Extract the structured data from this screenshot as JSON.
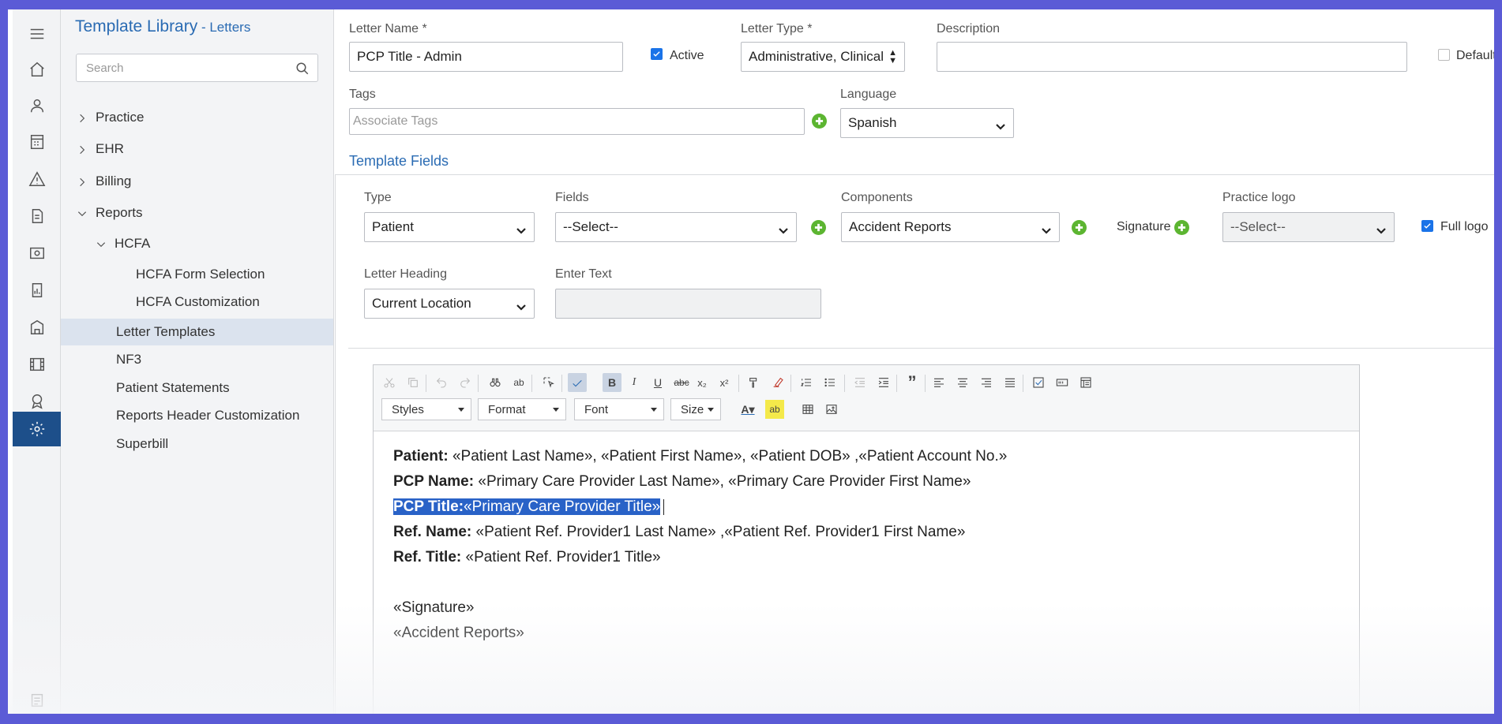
{
  "sidebar_title": {
    "main": "Template Library",
    "sub": " - Letters"
  },
  "search": {
    "placeholder": "Search"
  },
  "tree": {
    "practice": "Practice",
    "ehr": "EHR",
    "billing": "Billing",
    "reports": "Reports",
    "hcfa": "HCFA",
    "hcfa_form_selection": "HCFA Form Selection",
    "hcfa_customization": "HCFA Customization",
    "letter_templates": "Letter Templates",
    "nf3": "NF3",
    "patient_statements": "Patient Statements",
    "reports_header_customization": "Reports Header Customization",
    "superbill": "Superbill"
  },
  "form": {
    "letter_name_label": "Letter Name *",
    "letter_name_value": "PCP Title - Admin",
    "active_label": "Active",
    "active_checked": true,
    "letter_type_label": "Letter Type *",
    "letter_type_value": "Administrative, Clinical",
    "description_label": "Description",
    "description_value": "",
    "default_label": "Default",
    "default_checked": false,
    "tags_label": "Tags",
    "tags_placeholder": "Associate Tags",
    "language_label": "Language",
    "language_value": "Spanish"
  },
  "template_fields": {
    "title": "Template Fields",
    "type_label": "Type",
    "type_value": "Patient",
    "fields_label": "Fields",
    "fields_value": "--Select--",
    "components_label": "Components",
    "components_value": "Accident Reports",
    "signature_label": "Signature",
    "practice_logo_label": "Practice logo",
    "practice_logo_value": "--Select--",
    "full_logo_label": "Full logo",
    "full_logo_checked": true,
    "letter_heading_label": "Letter Heading",
    "letter_heading_value": "Current Location",
    "enter_text_label": "Enter Text",
    "enter_text_value": ""
  },
  "editor": {
    "styles": "Styles",
    "format": "Format",
    "font": "Font",
    "size": "Size",
    "lines": [
      {
        "label": "Patient:",
        "text": " «Patient Last Name», «Patient First Name», «Patient DOB» ,«Patient Account No.»"
      },
      {
        "label": "PCP Name:",
        "text": " «Primary Care Provider Last Name», «Primary Care Provider First Name»"
      },
      {
        "label": "PCP Title:",
        "text": "«Primary Care Provider Title»"
      },
      {
        "label": "Ref. Name:",
        "text": " «Patient Ref. Provider1 Last Name» ,«Patient Ref. Provider1 First Name»"
      },
      {
        "label": "Ref. Title:",
        "text": " «Patient Ref. Provider1 Title»"
      },
      {
        "label": "",
        "text": "«Signature»"
      },
      {
        "label": "",
        "text": "«Accident Reports»"
      }
    ]
  }
}
